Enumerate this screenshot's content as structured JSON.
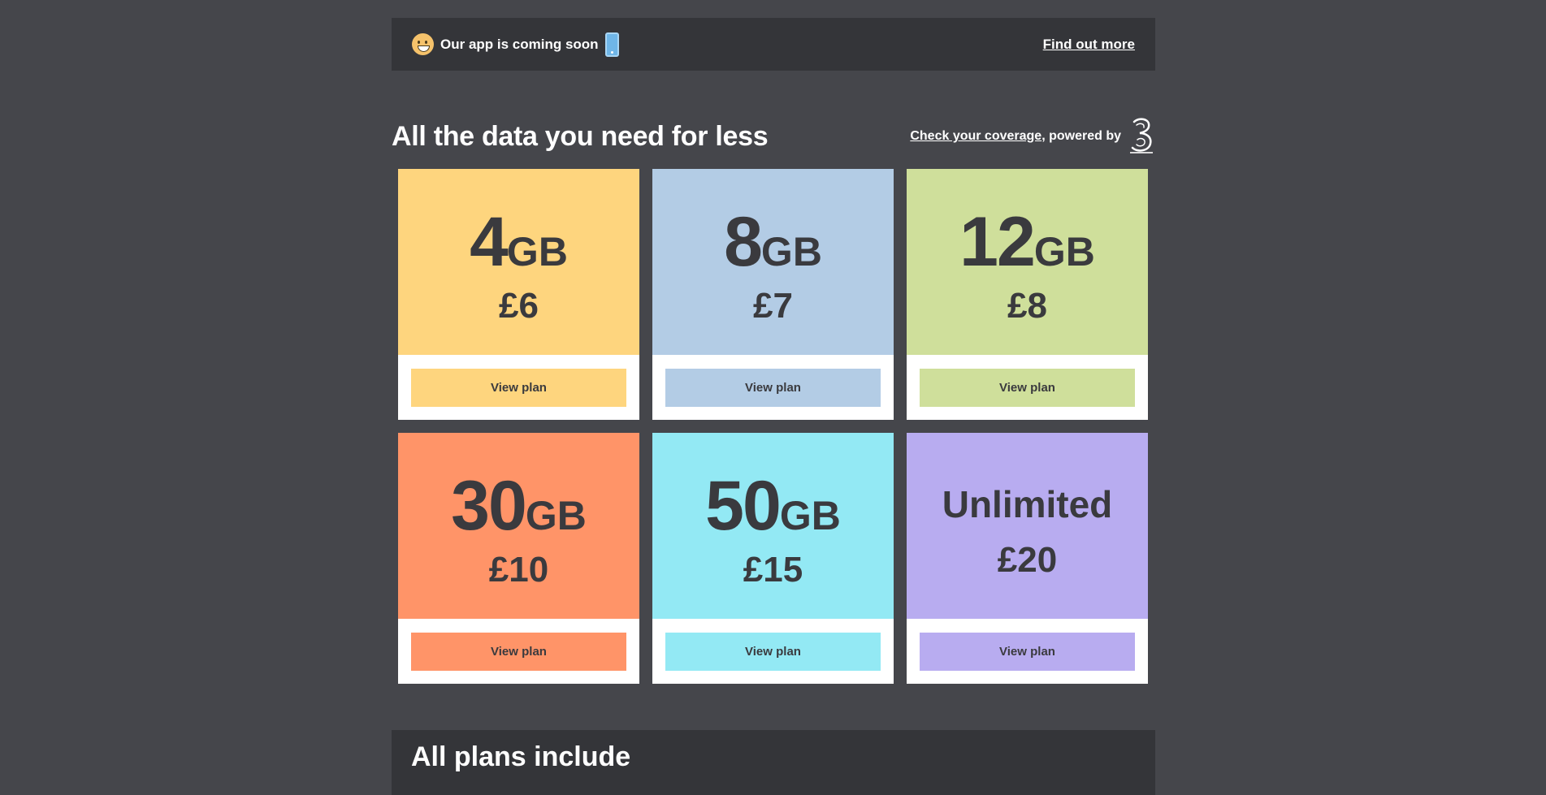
{
  "banner": {
    "icon_left": "smiley-face-icon",
    "text": "Our app is coming soon",
    "icon_right": "mobile-phone-icon",
    "link": "Find out more"
  },
  "main": {
    "title": "All the data you need for less",
    "coverage_link": "Check your coverage",
    "coverage_suffix": ", powered by",
    "logo": "three-logo"
  },
  "plans": [
    {
      "amount": "4",
      "unit": "GB",
      "price": "£6",
      "button": "View plan",
      "color": "#fed57e"
    },
    {
      "amount": "8",
      "unit": "GB",
      "price": "£7",
      "button": "View plan",
      "color": "#b3cce5"
    },
    {
      "amount": "12",
      "unit": "GB",
      "price": "£8",
      "button": "View plan",
      "color": "#cfdf9b"
    },
    {
      "amount": "30",
      "unit": "GB",
      "price": "£10",
      "button": "View plan",
      "color": "#ff9468"
    },
    {
      "amount": "50",
      "unit": "GB",
      "price": "£15",
      "button": "View plan",
      "color": "#93e9f4"
    },
    {
      "amount": "Unlimited",
      "unit": "",
      "price": "£20",
      "button": "View plan",
      "color": "#b8acf0"
    }
  ],
  "includes": {
    "title": "All plans include"
  },
  "colors": {
    "background": "#45464b",
    "panel": "#343539",
    "text_dark": "#3a3a3e"
  }
}
